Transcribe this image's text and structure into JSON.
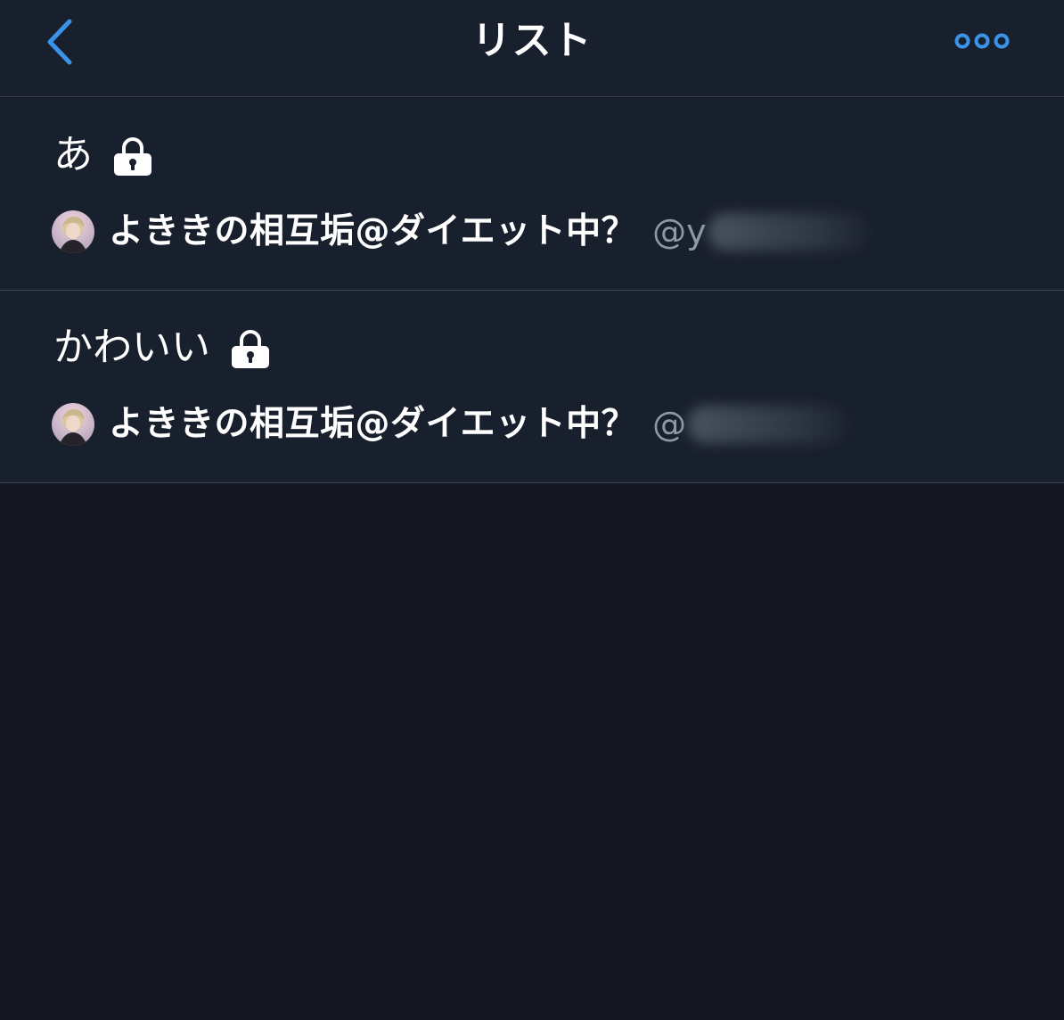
{
  "header": {
    "title": "リスト",
    "back_icon": "chevron-left-icon",
    "more_icon": "more-horizontal-icon"
  },
  "colors": {
    "accent": "#3b93e8",
    "background": "#141720",
    "panel": "#19202d",
    "divider": "#3a4452",
    "secondary_text": "#8b98a6"
  },
  "lists": [
    {
      "name": "あ",
      "private_icon": "lock-icon",
      "owner": {
        "display_name": "よききの相互垢@ダイエット中？",
        "handle_prefix": "@y"
      }
    },
    {
      "name": "かわいい",
      "private_icon": "lock-icon",
      "owner": {
        "display_name": "よききの相互垢@ダイエット中？",
        "handle_prefix": "@"
      }
    }
  ]
}
